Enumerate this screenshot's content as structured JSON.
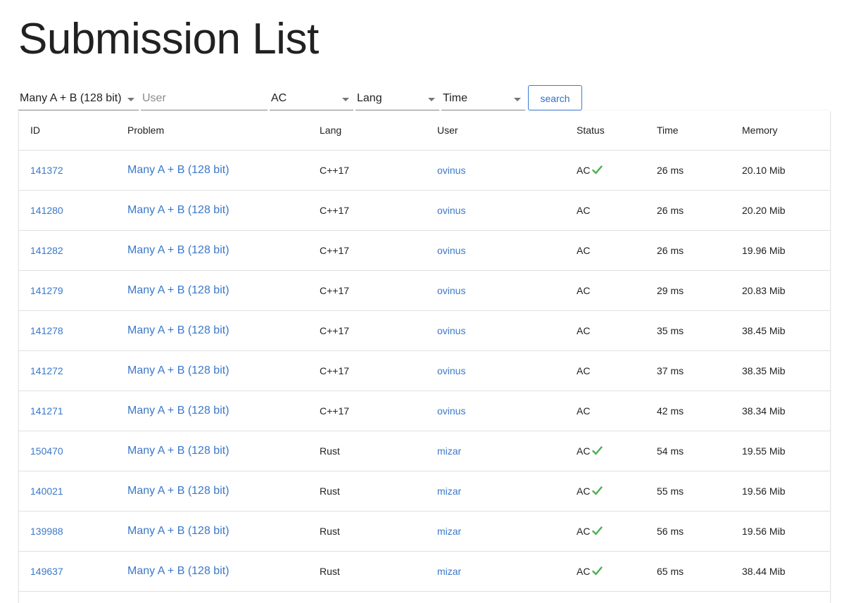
{
  "page": {
    "title": "Submission List"
  },
  "filters": {
    "problem": "Many A + B (128 bit)",
    "user_placeholder": "User",
    "status": "AC",
    "lang_placeholder": "Lang",
    "time_placeholder": "Time",
    "search_label": "search"
  },
  "table": {
    "columns": [
      "ID",
      "Problem",
      "Lang",
      "User",
      "Status",
      "Time",
      "Memory"
    ],
    "rows": [
      {
        "id": "141372",
        "problem": "Many A + B (128 bit)",
        "lang": "C++17",
        "user": "ovinus",
        "status": "AC",
        "check": true,
        "time": "26 ms",
        "memory": "20.10 Mib"
      },
      {
        "id": "141280",
        "problem": "Many A + B (128 bit)",
        "lang": "C++17",
        "user": "ovinus",
        "status": "AC",
        "check": false,
        "time": "26 ms",
        "memory": "20.20 Mib"
      },
      {
        "id": "141282",
        "problem": "Many A + B (128 bit)",
        "lang": "C++17",
        "user": "ovinus",
        "status": "AC",
        "check": false,
        "time": "26 ms",
        "memory": "19.96 Mib"
      },
      {
        "id": "141279",
        "problem": "Many A + B (128 bit)",
        "lang": "C++17",
        "user": "ovinus",
        "status": "AC",
        "check": false,
        "time": "29 ms",
        "memory": "20.83 Mib"
      },
      {
        "id": "141278",
        "problem": "Many A + B (128 bit)",
        "lang": "C++17",
        "user": "ovinus",
        "status": "AC",
        "check": false,
        "time": "35 ms",
        "memory": "38.45 Mib"
      },
      {
        "id": "141272",
        "problem": "Many A + B (128 bit)",
        "lang": "C++17",
        "user": "ovinus",
        "status": "AC",
        "check": false,
        "time": "37 ms",
        "memory": "38.35 Mib"
      },
      {
        "id": "141271",
        "problem": "Many A + B (128 bit)",
        "lang": "C++17",
        "user": "ovinus",
        "status": "AC",
        "check": false,
        "time": "42 ms",
        "memory": "38.34 Mib"
      },
      {
        "id": "150470",
        "problem": "Many A + B (128 bit)",
        "lang": "Rust",
        "user": "mizar",
        "status": "AC",
        "check": true,
        "time": "54 ms",
        "memory": "19.55 Mib"
      },
      {
        "id": "140021",
        "problem": "Many A + B (128 bit)",
        "lang": "Rust",
        "user": "mizar",
        "status": "AC",
        "check": true,
        "time": "55 ms",
        "memory": "19.56 Mib"
      },
      {
        "id": "139988",
        "problem": "Many A + B (128 bit)",
        "lang": "Rust",
        "user": "mizar",
        "status": "AC",
        "check": true,
        "time": "56 ms",
        "memory": "19.56 Mib"
      },
      {
        "id": "149637",
        "problem": "Many A + B (128 bit)",
        "lang": "Rust",
        "user": "mizar",
        "status": "AC",
        "check": true,
        "time": "65 ms",
        "memory": "38.44 Mib"
      }
    ]
  },
  "colors": {
    "link": "#3a78c9",
    "check": "#4caf50",
    "divider": "#e0e0e0"
  },
  "icons": {
    "check": "check-icon",
    "dropdown": "chevron-down-icon"
  }
}
